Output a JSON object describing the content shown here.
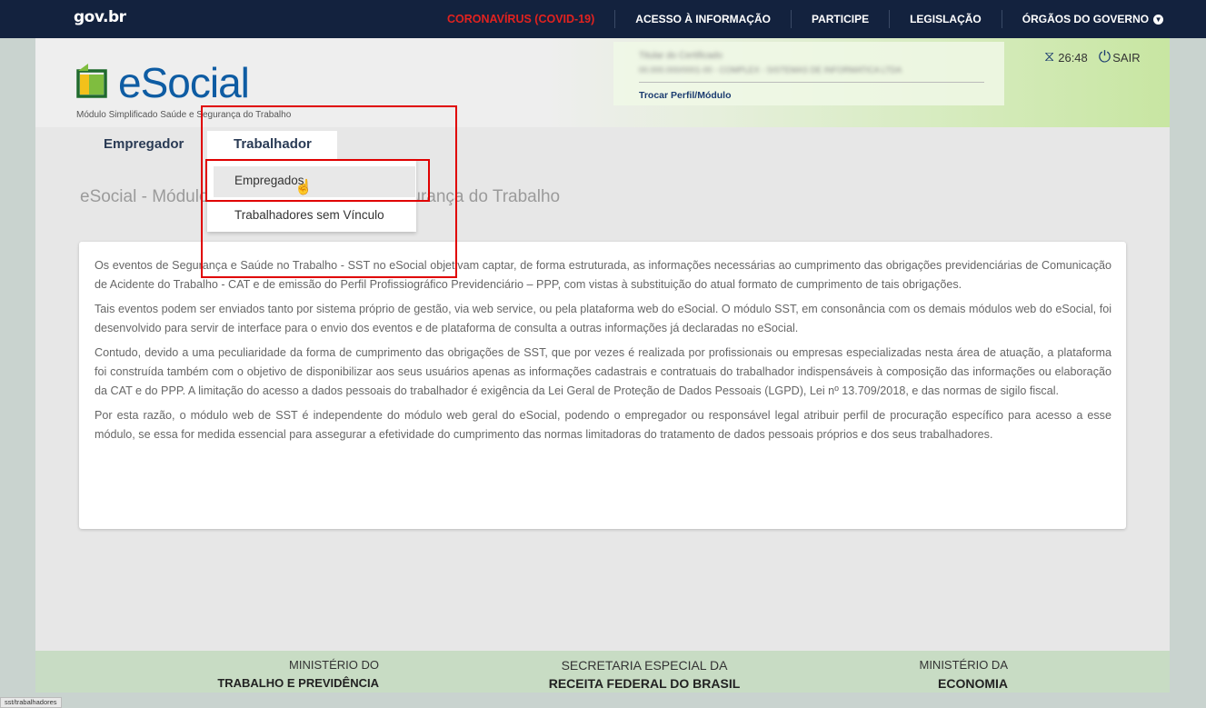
{
  "govbar": {
    "logo": "gov.br",
    "links": {
      "covid": "CORONAVÍRUS (COVID-19)",
      "acesso": "ACESSO À INFORMAÇÃO",
      "participe": "PARTICIPE",
      "legislacao": "LEGISLAÇÃO",
      "orgaos": "ÓRGÃOS DO GOVERNO"
    },
    "covid_color": "#e2221f"
  },
  "header": {
    "logo_text": "eSocial",
    "logo_subtitle": "Módulo Simplificado Saúde e Segurança do Trabalho",
    "profile": {
      "certificate_blurred": "Titular do Certificado",
      "org_blurred": "00.000.000/0001-00 - COMPLEX - SISTEMAS DE INFORMATICA LTDA",
      "switch_link": "Trocar Perfil/Módulo"
    },
    "session_timer": "26:48",
    "logout_label": "SAIR"
  },
  "nav": {
    "empregador": "Empregador",
    "trabalhador": "Trabalhador",
    "dropdown": [
      "Empregados",
      "Trabalhadores sem Vínculo"
    ]
  },
  "section_title": "eSocial - Módulo Simplificado Saúde e Segurança do Trabalho",
  "content": {
    "paragraphs": [
      "Os eventos de Segurança e Saúde no Trabalho - SST no eSocial objetivam captar, de forma estruturada, as informações necessárias ao cumprimento das obrigações previdenciárias de Comunicação de Acidente do Trabalho - CAT e de emissão do Perfil Profissiográfico Previdenciário – PPP, com vistas à substituição do atual formato de cumprimento de tais obrigações.",
      "Tais eventos podem ser enviados tanto por sistema próprio de gestão, via web service, ou pela plataforma web do eSocial. O módulo SST, em consonância com os demais módulos web do eSocial, foi desenvolvido para servir de interface para o envio dos eventos e de plataforma de consulta a outras informações já declaradas no eSocial.",
      "Contudo, devido a uma peculiaridade da forma de cumprimento das obrigações de SST, que por vezes é realizada por profissionais ou empresas especializadas nesta área de atuação, a plataforma foi construída também com o objetivo de disponibilizar aos seus usuários apenas as informações cadastrais e contratuais do trabalhador indispensáveis à composição das informações ou elaboração da CAT e do PPP. A limitação do acesso a dados pessoais do trabalhador é exigência da Lei Geral de Proteção de Dados Pessoais (LGPD), Lei nº 13.709/2018, e das normas de sigilo fiscal.",
      "Por esta razão, o módulo web de SST é independente do módulo web geral do eSocial, podendo o empregador ou responsável legal atribuir perfil de procuração específico para acesso a esse módulo, se essa for medida essencial para assegurar a efetividade do cumprimento das normas limitadoras do tratamento de dados pessoais próprios e dos seus trabalhadores."
    ]
  },
  "footer": {
    "org1_line1": "MINISTÉRIO DO",
    "org1_line2": "TRABALHO E PREVIDÊNCIA",
    "org2_line1": "SECRETARIA ESPECIAL DA",
    "org2_line2": "RECEITA FEDERAL DO BRASIL",
    "org3_line1": "MINISTÉRIO DA",
    "org3_line2": "ECONOMIA"
  },
  "statusbar": "sst/trabalhadores",
  "icons": {
    "timer": "hourglass-icon",
    "logout": "power-icon",
    "dropdown": "chevron-down-icon",
    "cursor": "hand-pointer-icon"
  },
  "colors": {
    "govbar_bg": "#13223e",
    "brand_blue": "#0e5ca3",
    "highlight_red": "#e00000"
  }
}
